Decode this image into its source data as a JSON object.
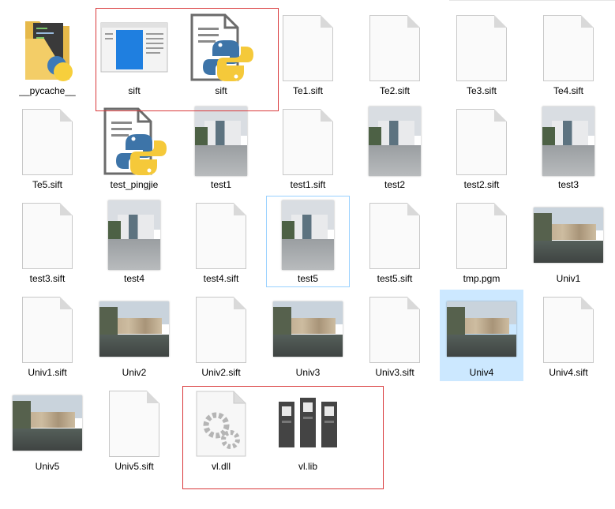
{
  "files": [
    {
      "name": "__pycache__",
      "kind": "folder"
    },
    {
      "name": "sift",
      "kind": "app"
    },
    {
      "name": "sift",
      "kind": "python"
    },
    {
      "name": "Te1.sift",
      "kind": "file"
    },
    {
      "name": "Te2.sift",
      "kind": "file"
    },
    {
      "name": "Te3.sift",
      "kind": "file"
    },
    {
      "name": "Te4.sift",
      "kind": "file"
    },
    {
      "name": "Te5.sift",
      "kind": "file"
    },
    {
      "name": "test_pingjie",
      "kind": "python"
    },
    {
      "name": "test1",
      "kind": "photo-portrait"
    },
    {
      "name": "test1.sift",
      "kind": "file"
    },
    {
      "name": "test2",
      "kind": "photo-portrait"
    },
    {
      "name": "test2.sift",
      "kind": "file"
    },
    {
      "name": "test3",
      "kind": "photo-portrait"
    },
    {
      "name": "test3.sift",
      "kind": "file"
    },
    {
      "name": "test4",
      "kind": "photo-portrait"
    },
    {
      "name": "test4.sift",
      "kind": "file"
    },
    {
      "name": "test5",
      "kind": "photo-portrait"
    },
    {
      "name": "test5.sift",
      "kind": "file"
    },
    {
      "name": "tmp.pgm",
      "kind": "file"
    },
    {
      "name": "Univ1",
      "kind": "photo-landscape"
    },
    {
      "name": "Univ1.sift",
      "kind": "file"
    },
    {
      "name": "Univ2",
      "kind": "photo-landscape"
    },
    {
      "name": "Univ2.sift",
      "kind": "file"
    },
    {
      "name": "Univ3",
      "kind": "photo-landscape"
    },
    {
      "name": "Univ3.sift",
      "kind": "file"
    },
    {
      "name": "Univ4",
      "kind": "photo-landscape"
    },
    {
      "name": "Univ4.sift",
      "kind": "file"
    },
    {
      "name": "Univ5",
      "kind": "photo-landscape"
    },
    {
      "name": "Univ5.sift",
      "kind": "file"
    },
    {
      "name": "vl.dll",
      "kind": "dll"
    },
    {
      "name": "vl.lib",
      "kind": "lib"
    }
  ],
  "selected_item": "Univ4",
  "focused_item": "test5",
  "colors": {
    "selection": "#cce8ff",
    "focus_border": "#99d1ff",
    "highlight_box": "#d9383a"
  }
}
